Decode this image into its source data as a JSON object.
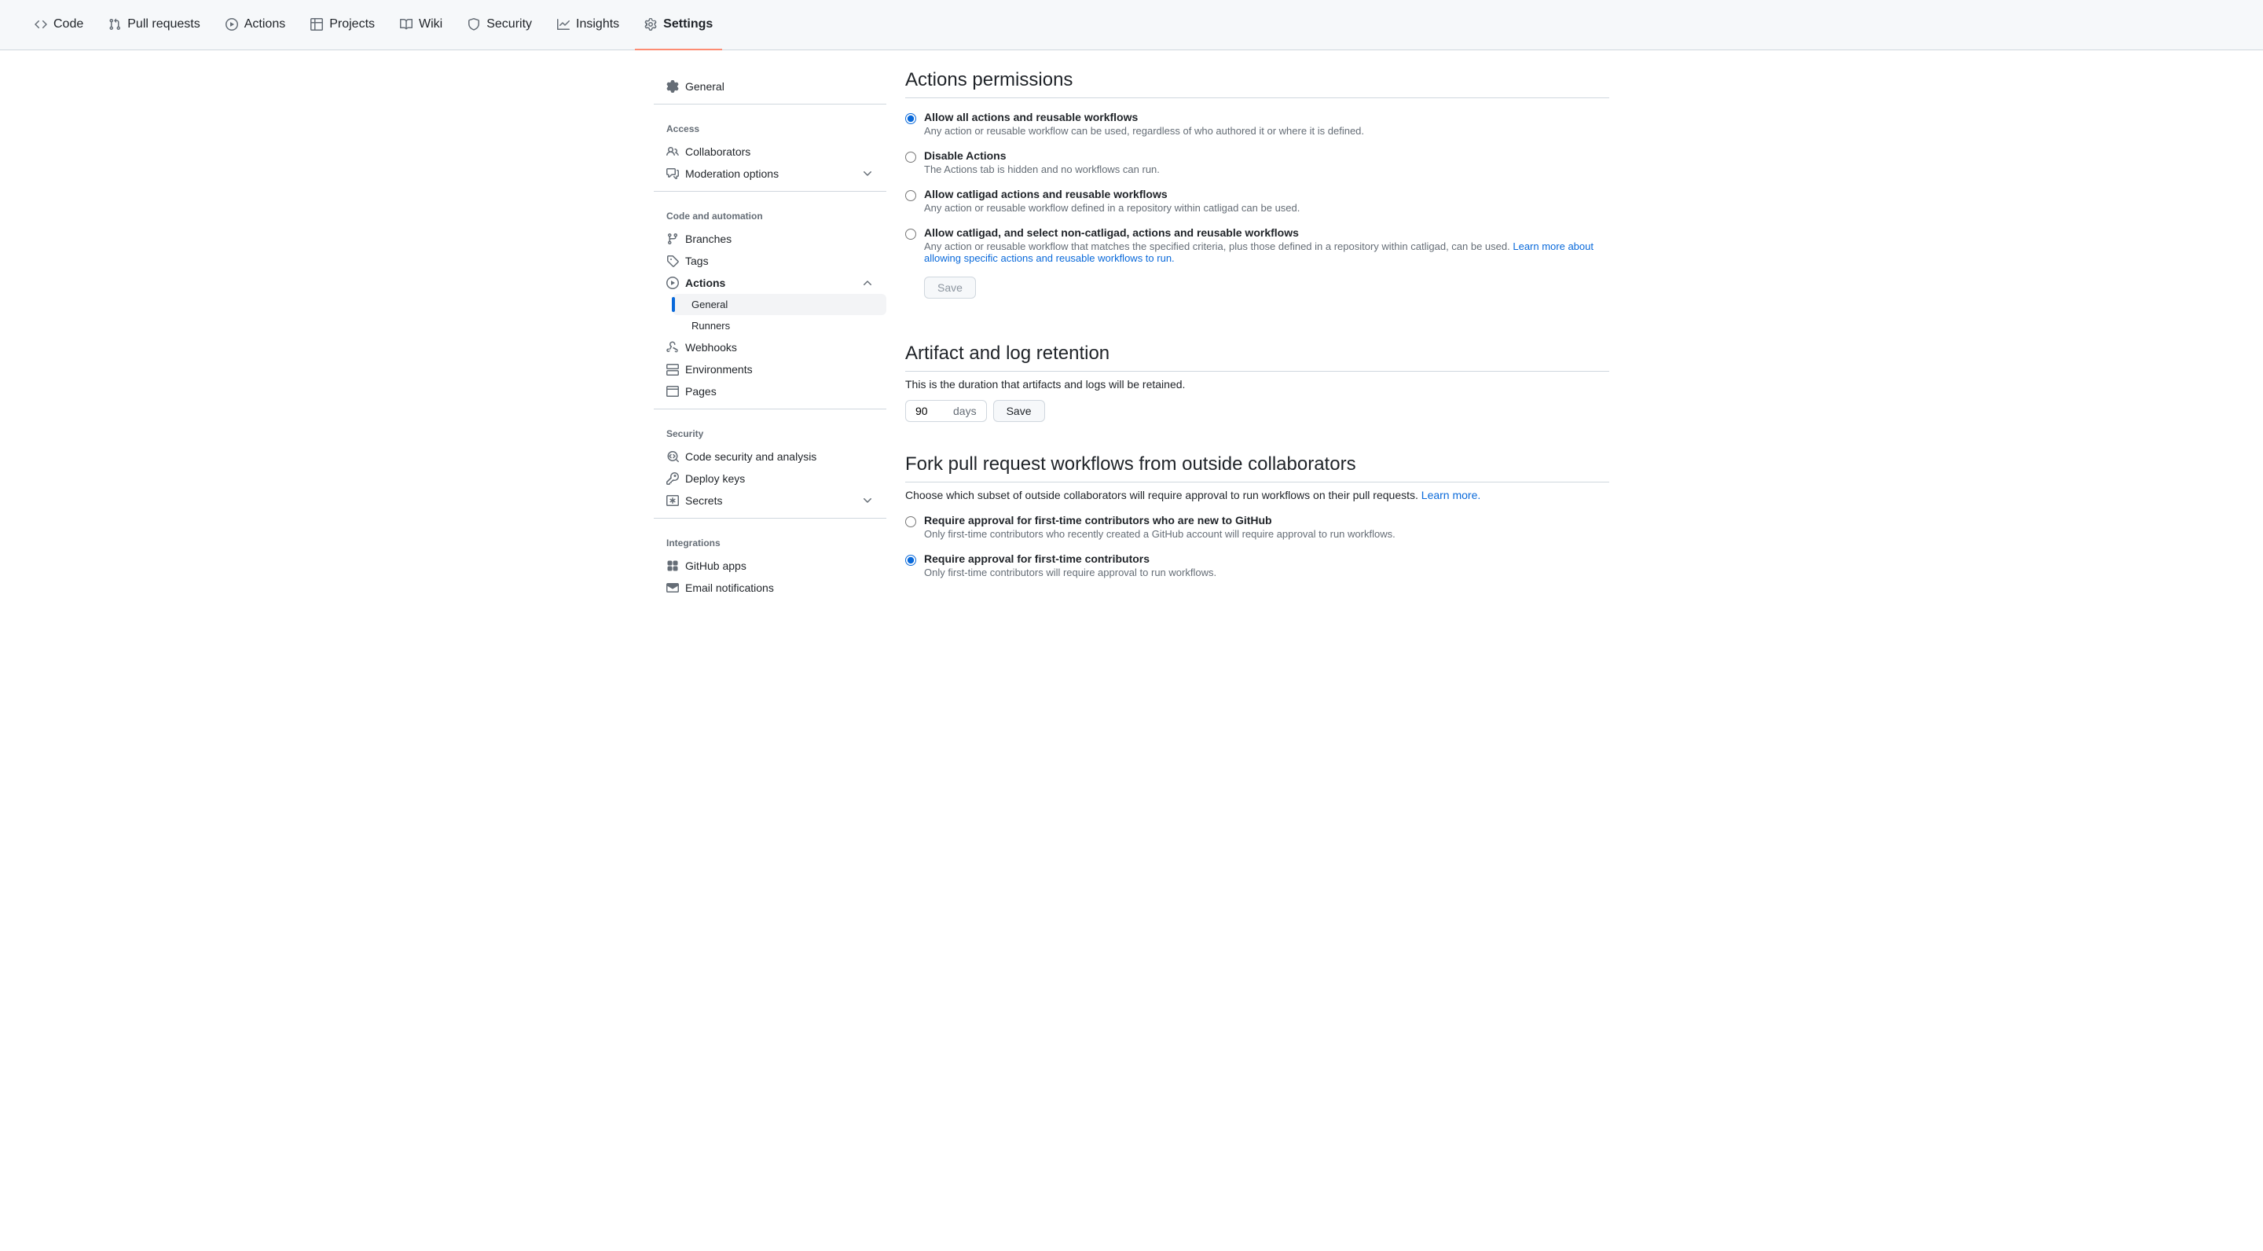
{
  "topnav": [
    {
      "label": "Code"
    },
    {
      "label": "Pull requests"
    },
    {
      "label": "Actions"
    },
    {
      "label": "Projects"
    },
    {
      "label": "Wiki"
    },
    {
      "label": "Security"
    },
    {
      "label": "Insights"
    },
    {
      "label": "Settings"
    }
  ],
  "sidebar": {
    "general": "General",
    "access_heading": "Access",
    "collaborators": "Collaborators",
    "moderation": "Moderation options",
    "code_auto_heading": "Code and automation",
    "branches": "Branches",
    "tags": "Tags",
    "actions": "Actions",
    "actions_general": "General",
    "actions_runners": "Runners",
    "webhooks": "Webhooks",
    "environments": "Environments",
    "pages": "Pages",
    "security_heading": "Security",
    "code_security": "Code security and analysis",
    "deploy_keys": "Deploy keys",
    "secrets": "Secrets",
    "integrations_heading": "Integrations",
    "github_apps": "GitHub apps",
    "email_notifications": "Email notifications"
  },
  "permissions": {
    "title": "Actions permissions",
    "opt1_label": "Allow all actions and reusable workflows",
    "opt1_desc": "Any action or reusable workflow can be used, regardless of who authored it or where it is defined.",
    "opt2_label": "Disable Actions",
    "opt2_desc": "The Actions tab is hidden and no workflows can run.",
    "opt3_label": "Allow catligad actions and reusable workflows",
    "opt3_desc": "Any action or reusable workflow defined in a repository within catligad can be used.",
    "opt4_label": "Allow catligad, and select non-catligad, actions and reusable workflows",
    "opt4_desc": "Any action or reusable workflow that matches the specified criteria, plus those defined in a repository within catligad, can be used. ",
    "opt4_link": "Learn more about allowing specific actions and reusable workflows to run.",
    "save": "Save"
  },
  "retention": {
    "title": "Artifact and log retention",
    "desc": "This is the duration that artifacts and logs will be retained.",
    "value": "90",
    "unit": "days",
    "save": "Save"
  },
  "fork": {
    "title": "Fork pull request workflows from outside collaborators",
    "desc": "Choose which subset of outside collaborators will require approval to run workflows on their pull requests. ",
    "learn_more": "Learn more.",
    "opt1_label": "Require approval for first-time contributors who are new to GitHub",
    "opt1_desc": "Only first-time contributors who recently created a GitHub account will require approval to run workflows.",
    "opt2_label": "Require approval for first-time contributors",
    "opt2_desc": "Only first-time contributors will require approval to run workflows."
  }
}
